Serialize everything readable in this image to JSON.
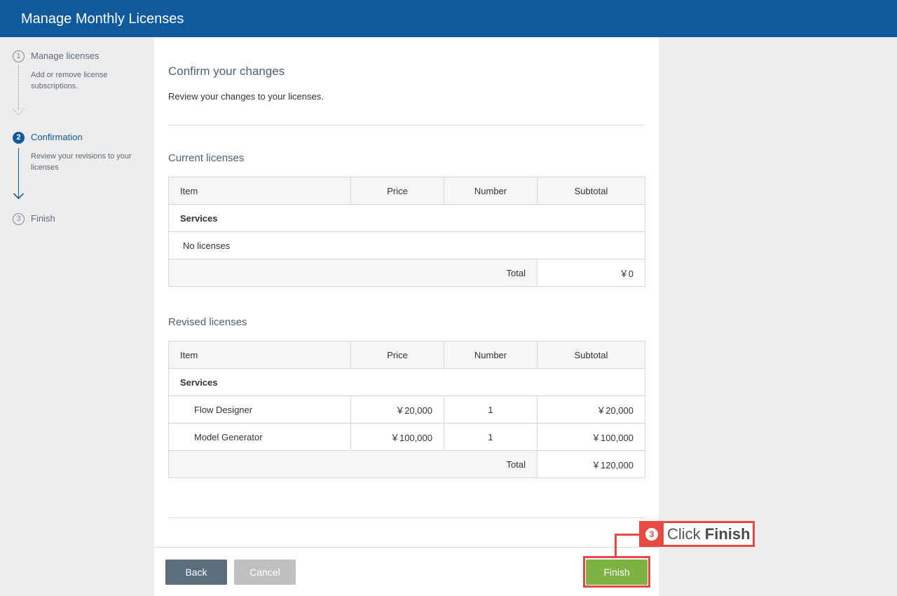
{
  "header": {
    "title": "Manage Monthly Licenses"
  },
  "steps": [
    {
      "num": "1",
      "title": "Manage licenses",
      "desc": "Add or remove license subscriptions."
    },
    {
      "num": "2",
      "title": "Confirmation",
      "desc": "Review your revisions to your licenses"
    },
    {
      "num": "3",
      "title": "Finish"
    }
  ],
  "main": {
    "title": "Confirm your changes",
    "subtitle": "Review your changes to your licenses."
  },
  "current": {
    "title": "Current licenses",
    "headers": {
      "item": "Item",
      "price": "Price",
      "number": "Number",
      "subtotal": "Subtotal"
    },
    "group": "Services",
    "empty": "No licenses",
    "total_label": "Total",
    "total_value": "￥0"
  },
  "revised": {
    "title": "Revised licenses",
    "headers": {
      "item": "Item",
      "price": "Price",
      "number": "Number",
      "subtotal": "Subtotal"
    },
    "group": "Services",
    "rows": [
      {
        "item": "Flow Designer",
        "price": "￥20,000",
        "number": "1",
        "subtotal": "￥20,000"
      },
      {
        "item": "Model Generator",
        "price": "￥100,000",
        "number": "1",
        "subtotal": "￥100,000"
      }
    ],
    "total_label": "Total",
    "total_value": "￥120,000"
  },
  "buttons": {
    "back": "Back",
    "cancel": "Cancel",
    "finish": "Finish"
  },
  "callout": {
    "num": "3",
    "prefix": "Click ",
    "bold": "Finish"
  },
  "colors": {
    "header": "#0e5a9c",
    "finish": "#7cb342",
    "back": "#5a6e7c",
    "cancel": "#c0c0c0",
    "highlight": "#e84a43"
  }
}
